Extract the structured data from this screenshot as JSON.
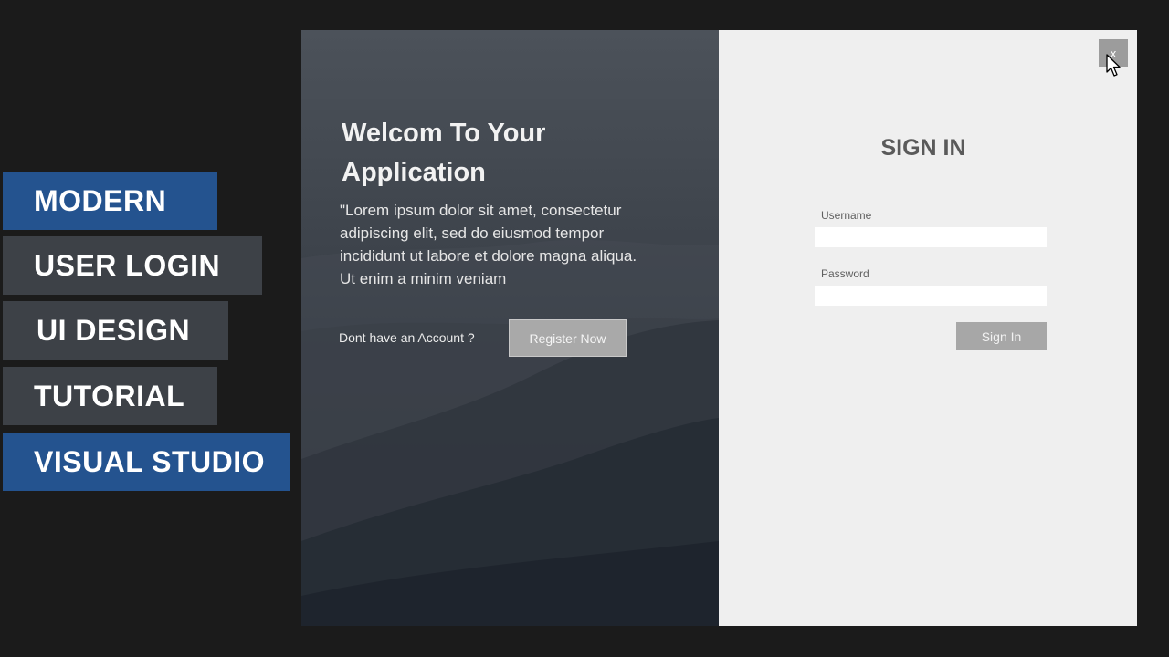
{
  "tutorial_tags": [
    {
      "label": "MODERN",
      "color": "#24538f"
    },
    {
      "label": "USER LOGIN",
      "color": "#3d4147"
    },
    {
      "label": "UI DESIGN",
      "color": "#3d4147"
    },
    {
      "label": "TUTORIAL",
      "color": "#3d4147"
    },
    {
      "label": "VISUAL STUDIO",
      "color": "#24538f"
    }
  ],
  "left_panel": {
    "welcome_title": "Welcom To Your Application",
    "description": "\"Lorem ipsum dolor sit amet, consectetur adipiscing elit, sed do eiusmod tempor incididunt ut labore et dolore magna aliqua. Ut enim a minim veniam",
    "no_account_text": "Dont have an Account ?",
    "register_button": "Register Now"
  },
  "right_panel": {
    "close_button": "x",
    "title": "SIGN IN",
    "username_label": "Username",
    "username_value": "",
    "password_label": "Password",
    "password_value": "",
    "signin_button": "Sign In"
  },
  "icons": {
    "close": "close-icon",
    "cursor": "mouse-pointer-icon"
  }
}
